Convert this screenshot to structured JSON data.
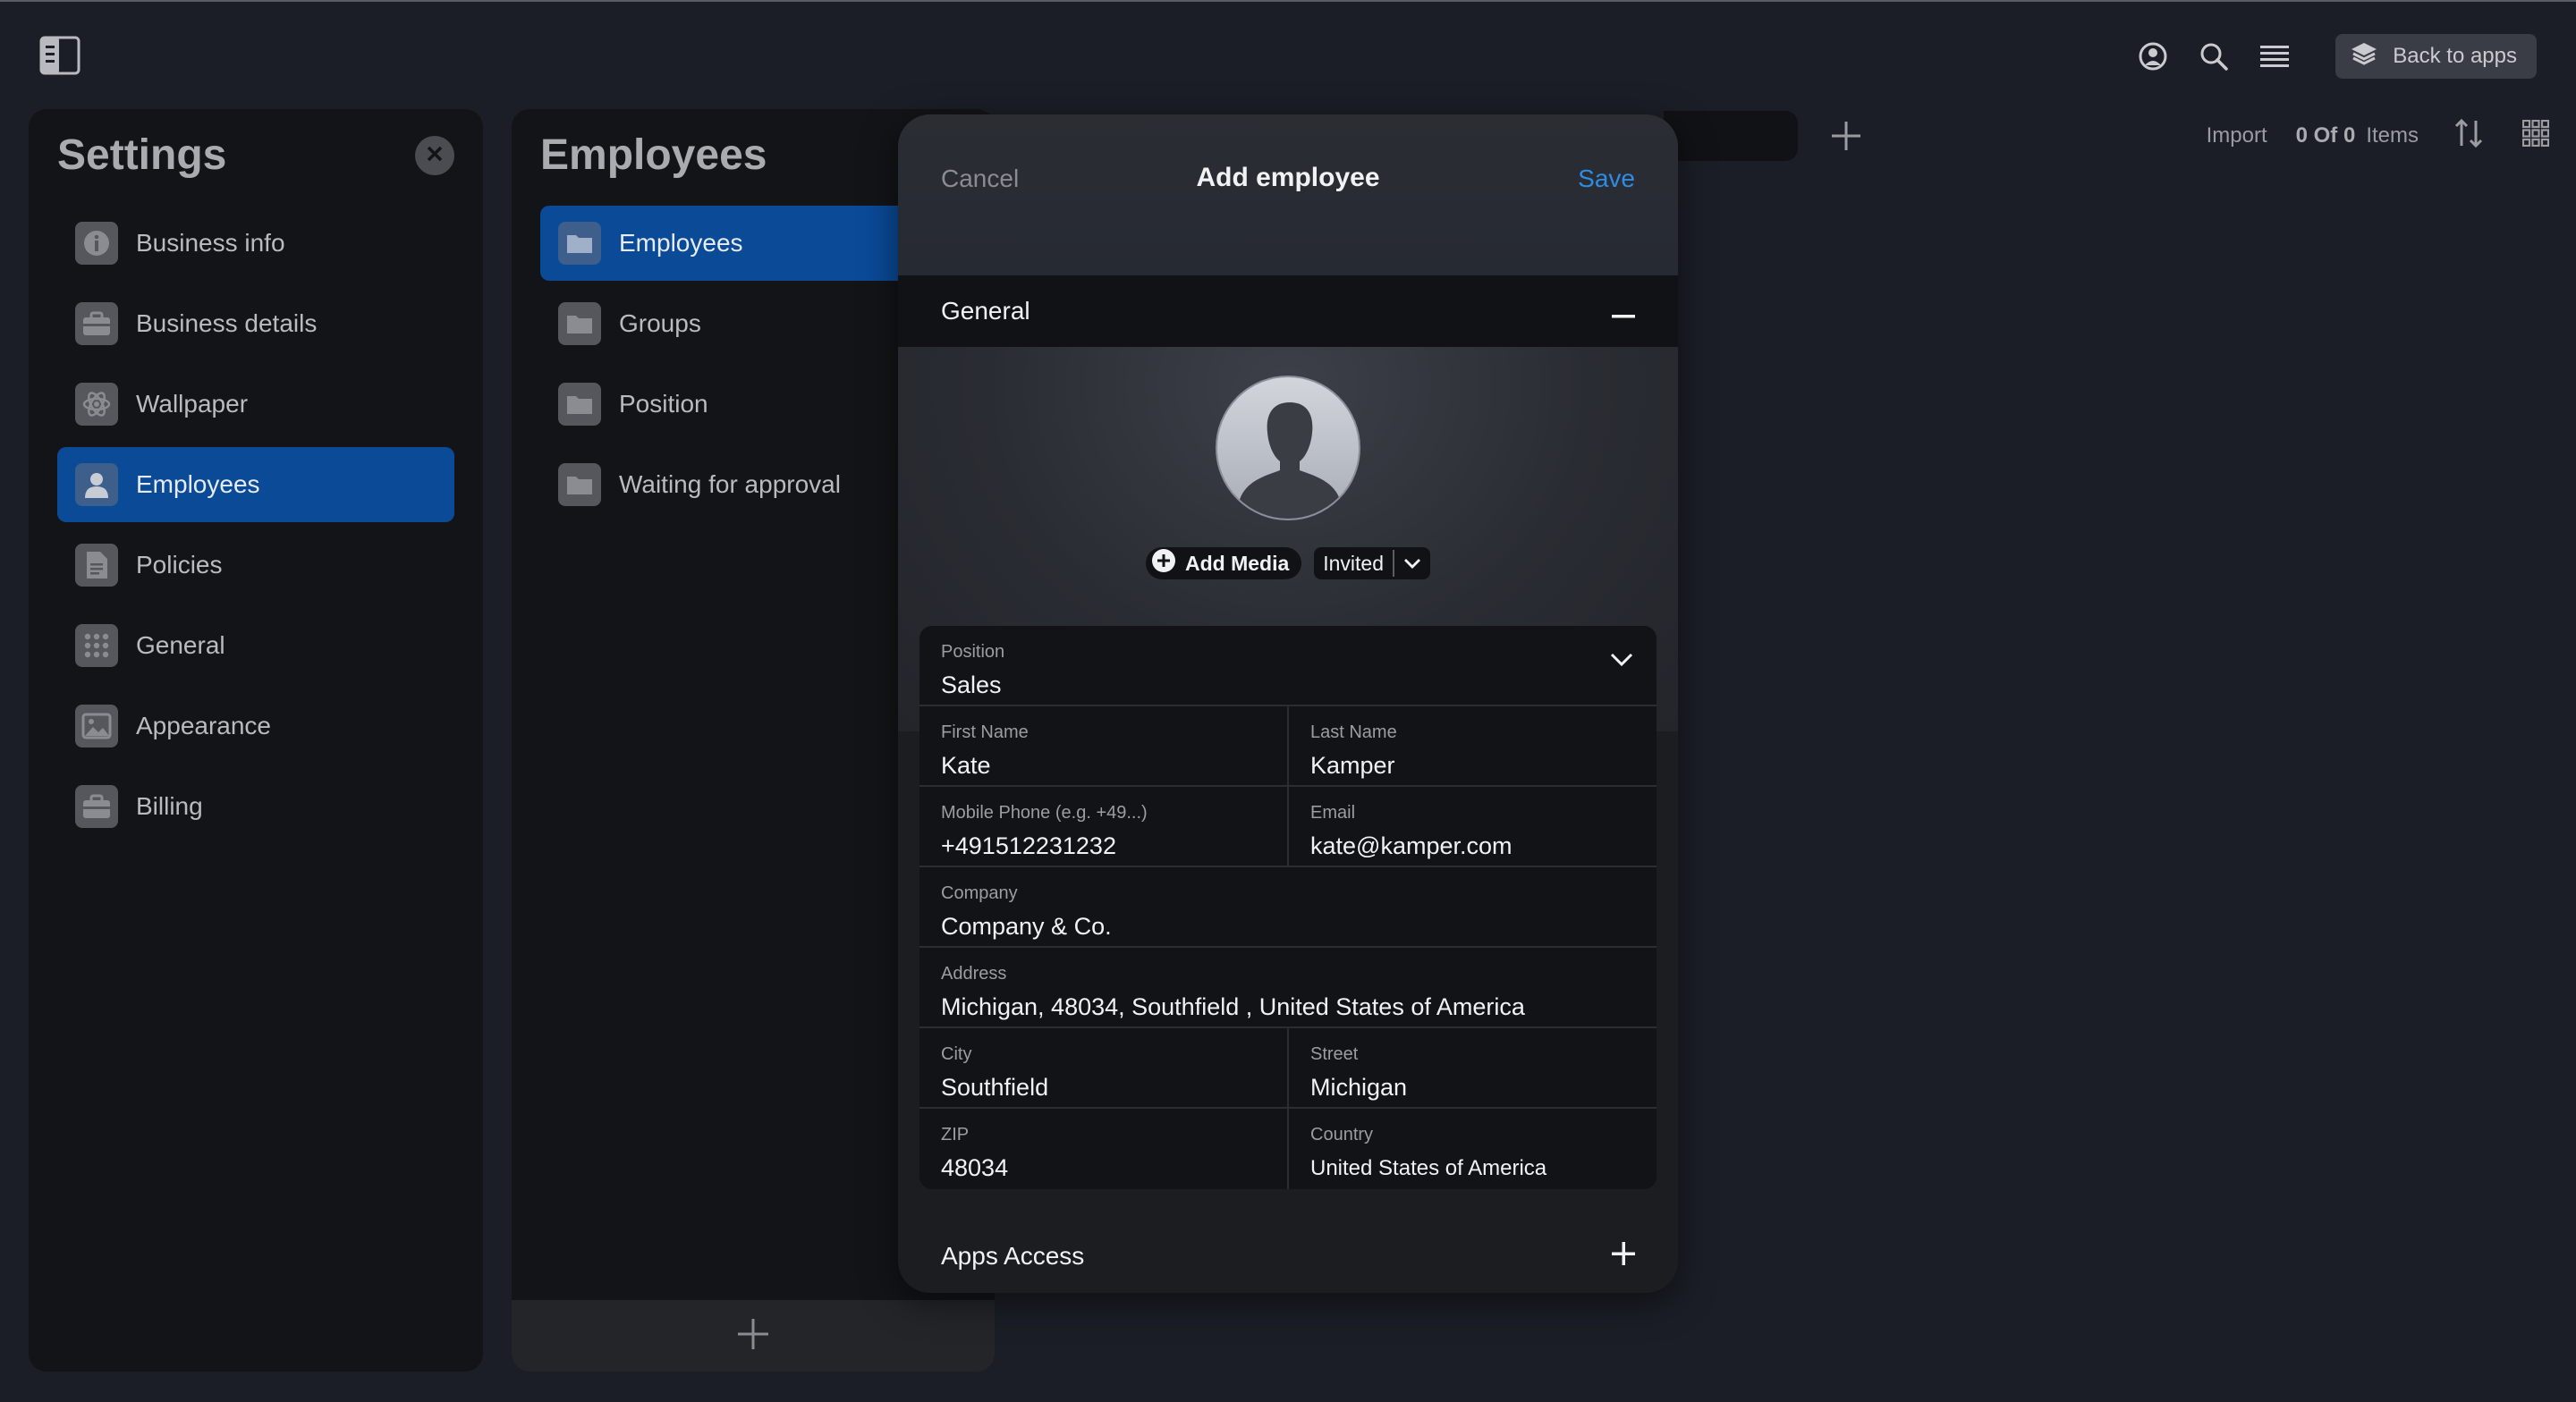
{
  "topbar": {
    "back_label": "Back to apps",
    "icons": [
      "sidebar-toggle-icon",
      "user-circle-icon",
      "search-icon",
      "menu-icon",
      "layers-icon"
    ]
  },
  "settings": {
    "title": "Settings",
    "items": [
      {
        "label": "Business info",
        "icon": "info-icon"
      },
      {
        "label": "Business details",
        "icon": "briefcase-icon"
      },
      {
        "label": "Wallpaper",
        "icon": "atom-icon"
      },
      {
        "label": "Employees",
        "icon": "person-icon",
        "active": true
      },
      {
        "label": "Policies",
        "icon": "document-icon"
      },
      {
        "label": "General",
        "icon": "grid-dots-icon"
      },
      {
        "label": "Appearance",
        "icon": "image-icon"
      },
      {
        "label": "Billing",
        "icon": "briefcase-icon"
      }
    ]
  },
  "employees": {
    "title": "Employees",
    "items": [
      {
        "label": "Employees",
        "active": true
      },
      {
        "label": "Groups"
      },
      {
        "label": "Position"
      },
      {
        "label": "Waiting for approval"
      }
    ]
  },
  "toolbar": {
    "import_label": "Import",
    "count_label": "0 Of 0",
    "items_label": "Items"
  },
  "modal": {
    "cancel_label": "Cancel",
    "title": "Add employee",
    "save_label": "Save",
    "general_label": "General",
    "add_media_label": "Add Media",
    "status_value": "Invited",
    "apps_access_label": "Apps Access",
    "fields": {
      "position": {
        "label": "Position",
        "value": "Sales"
      },
      "first_name": {
        "label": "First Name",
        "value": "Kate"
      },
      "last_name": {
        "label": "Last Name",
        "value": "Kamper"
      },
      "mobile": {
        "label": "Mobile Phone (e.g. +49...)",
        "value": "+491512231232"
      },
      "email": {
        "label": "Email",
        "value": "kate@kamper.com"
      },
      "company": {
        "label": "Company",
        "value": "Company & Co."
      },
      "address": {
        "label": "Address",
        "value": "Michigan, 48034, Southfield , United States of America"
      },
      "city": {
        "label": "City",
        "value": "Southfield"
      },
      "street": {
        "label": "Street",
        "value": "Michigan"
      },
      "zip": {
        "label": "ZIP",
        "value": "48034"
      },
      "country": {
        "label": "Country",
        "value": "United States of America"
      }
    }
  },
  "colors": {
    "accent": "#0a4a97",
    "save_link": "#2f8ce2",
    "background": "#1b1e26"
  }
}
